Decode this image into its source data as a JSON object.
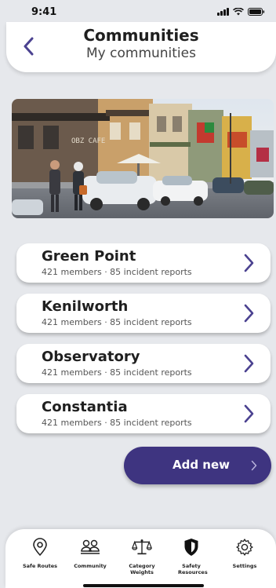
{
  "status": {
    "time": "9:41"
  },
  "header": {
    "title": "Communities",
    "subtitle": "My communities"
  },
  "photo": {
    "storefront_sign": "OBZ CAFE"
  },
  "communities": [
    {
      "name": "Green Point",
      "meta": "421 members · 85 incident reports"
    },
    {
      "name": "Kenilworth",
      "meta": "421 members · 85 incident reports"
    },
    {
      "name": "Observatory",
      "meta": "421 members · 85 incident reports"
    },
    {
      "name": "Constantia",
      "meta": "421 members · 85 incident reports"
    }
  ],
  "add_button": {
    "label": "Add new"
  },
  "nav": {
    "items": [
      {
        "label": "Safe Routes",
        "icon": "map-pin-icon"
      },
      {
        "label": "Community",
        "icon": "people-icon"
      },
      {
        "label": "Category Weights",
        "icon": "scales-icon"
      },
      {
        "label": "Safety Resources",
        "icon": "shield-icon"
      },
      {
        "label": "Settings",
        "icon": "gear-icon"
      }
    ]
  },
  "colors": {
    "accent": "#3e3480",
    "chevron": "#4b4290",
    "background": "#e6e8ec"
  }
}
